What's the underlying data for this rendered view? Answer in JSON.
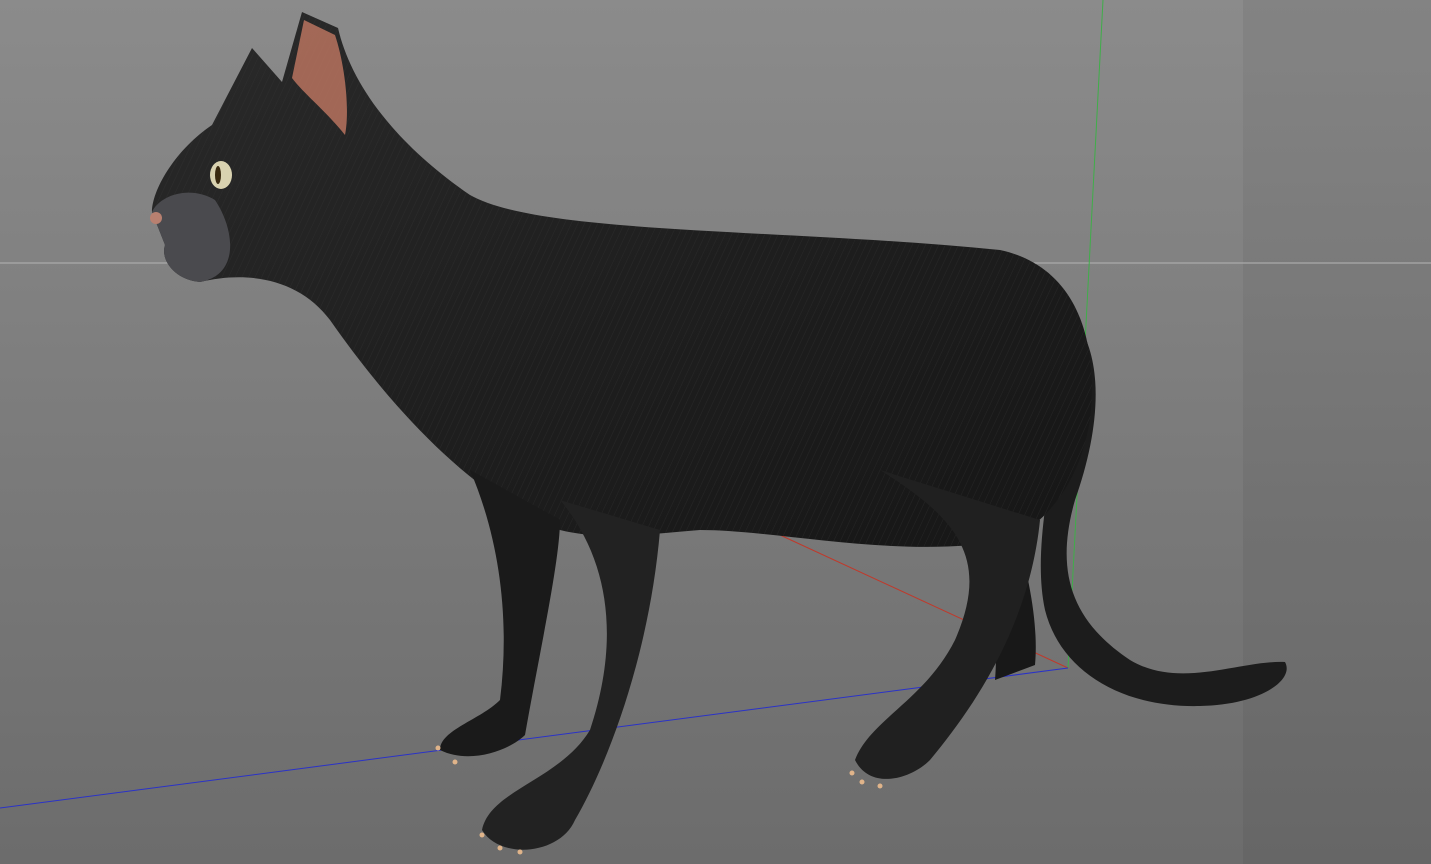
{
  "viewport": {
    "scene_object": "black-cat-model",
    "colors": {
      "background_top": "#8a8a8a",
      "background_bottom": "#6e6e6e",
      "side_panel": "#797979",
      "horizon": "#b5b5b5",
      "axis_x": "#c0392b",
      "axis_y": "#3fae49",
      "axis_z": "#2a32c8",
      "fur": "#1e1e1e",
      "ear_inner": "#b8735f",
      "eye": "#d9d2b0",
      "claw": "#e0b48a"
    }
  }
}
